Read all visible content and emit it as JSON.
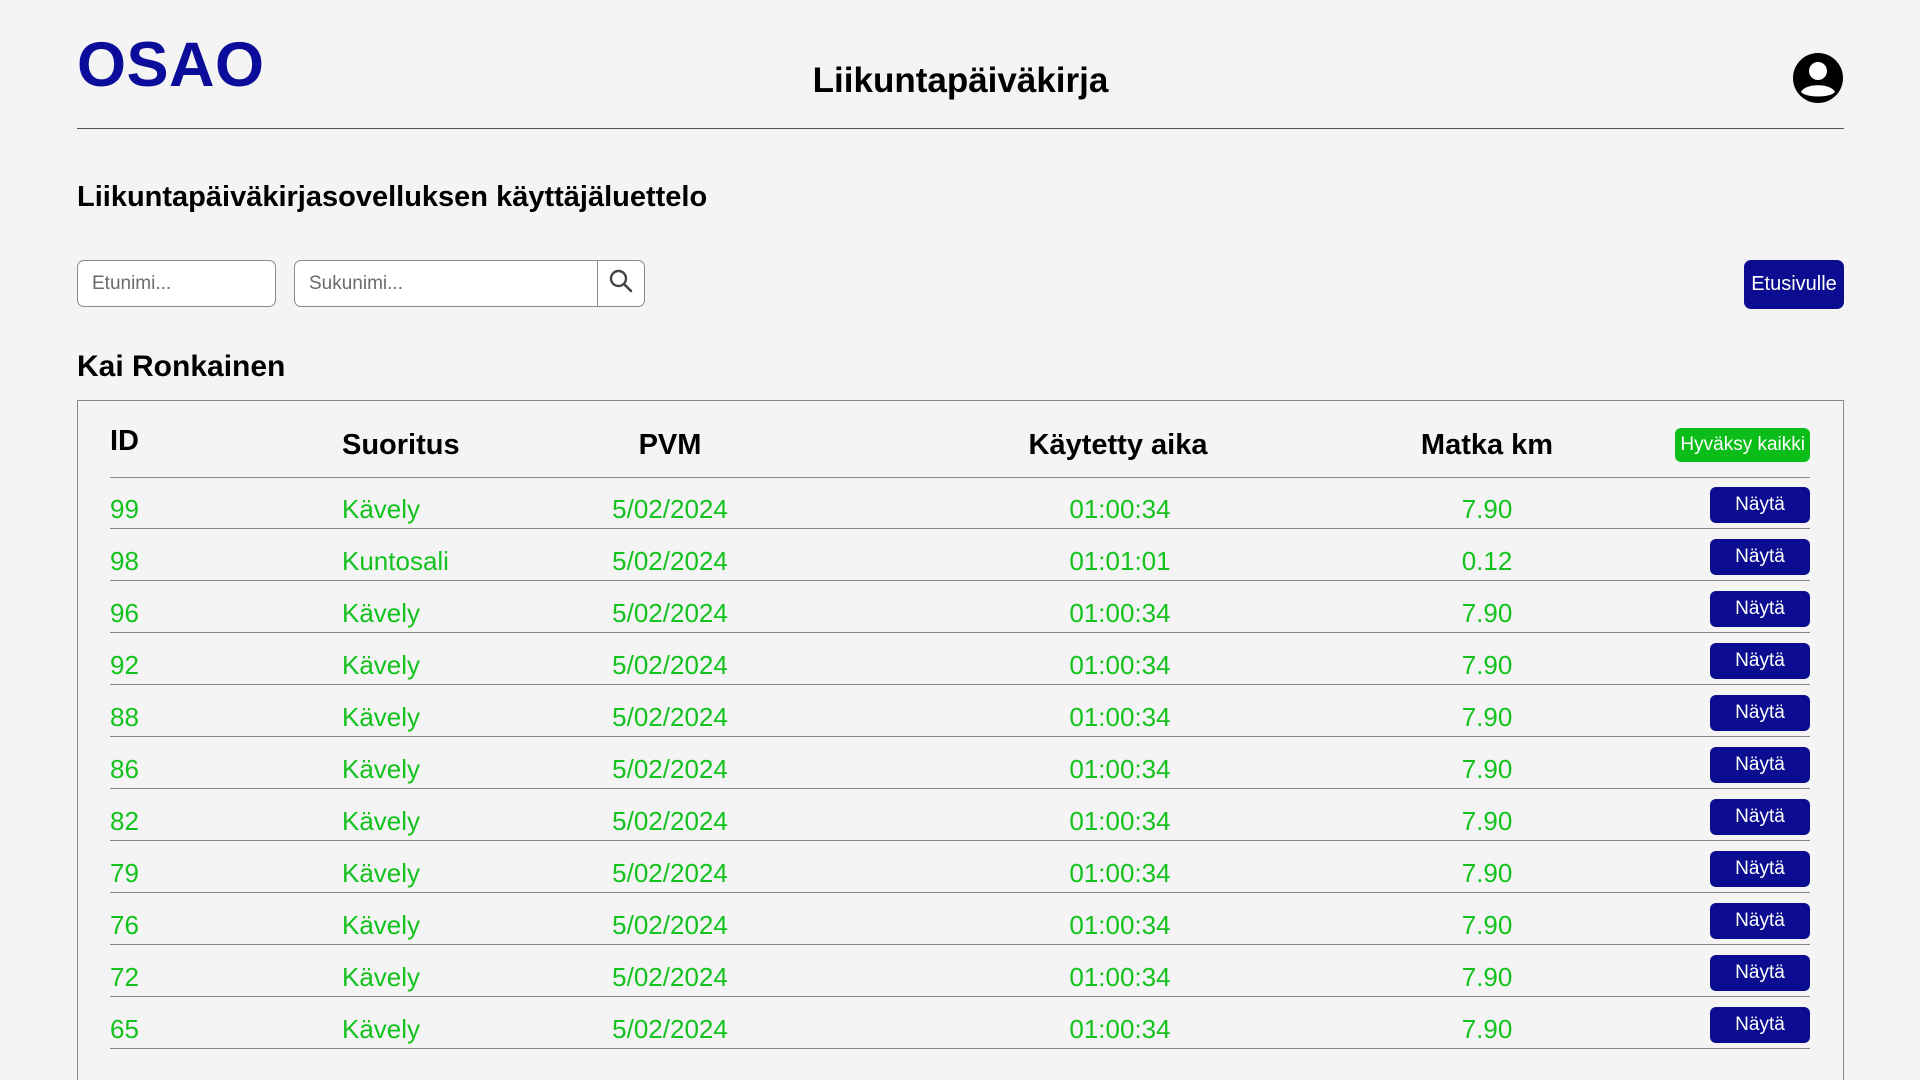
{
  "header": {
    "logo": "OSAO",
    "title": "Liikuntapäiväkirja",
    "user_icon": "account-circle-icon"
  },
  "page_heading": "Liikuntapäiväkirjasovelluksen käyttäjäluettelo",
  "search": {
    "first_name_placeholder": "Etunimi...",
    "last_name_placeholder": "Sukunimi...",
    "search_icon": "search-icon",
    "home_button_label": "Etusivulle"
  },
  "user_name": "Kai Ronkainen",
  "colors": {
    "brand": "#0b0c9a",
    "primary_button": "#0b0c8f",
    "approve_button": "#0bbd18",
    "row_text": "#14c21e",
    "background": "#f4f4f4"
  },
  "table": {
    "columns": [
      "ID",
      "Suoritus",
      "PVM",
      "Käytetty aika",
      "Matka km"
    ],
    "approve_all_label": "Hyväksy kaikki",
    "show_label": "Näytä",
    "rows": [
      {
        "id": "99",
        "activity": "Kävely",
        "date": "5/02/2024",
        "time": "01:00:34",
        "km": "7.90"
      },
      {
        "id": "98",
        "activity": "Kuntosali",
        "date": "5/02/2024",
        "time": "01:01:01",
        "km": "0.12"
      },
      {
        "id": "96",
        "activity": "Kävely",
        "date": "5/02/2024",
        "time": "01:00:34",
        "km": "7.90"
      },
      {
        "id": "92",
        "activity": "Kävely",
        "date": "5/02/2024",
        "time": "01:00:34",
        "km": "7.90"
      },
      {
        "id": "88",
        "activity": "Kävely",
        "date": "5/02/2024",
        "time": "01:00:34",
        "km": "7.90"
      },
      {
        "id": "86",
        "activity": "Kävely",
        "date": "5/02/2024",
        "time": "01:00:34",
        "km": "7.90"
      },
      {
        "id": "82",
        "activity": "Kävely",
        "date": "5/02/2024",
        "time": "01:00:34",
        "km": "7.90"
      },
      {
        "id": "79",
        "activity": "Kävely",
        "date": "5/02/2024",
        "time": "01:00:34",
        "km": "7.90"
      },
      {
        "id": "76",
        "activity": "Kävely",
        "date": "5/02/2024",
        "time": "01:00:34",
        "km": "7.90"
      },
      {
        "id": "72",
        "activity": "Kävely",
        "date": "5/02/2024",
        "time": "01:00:34",
        "km": "7.90"
      },
      {
        "id": "65",
        "activity": "Kävely",
        "date": "5/02/2024",
        "time": "01:00:34",
        "km": "7.90"
      }
    ]
  }
}
